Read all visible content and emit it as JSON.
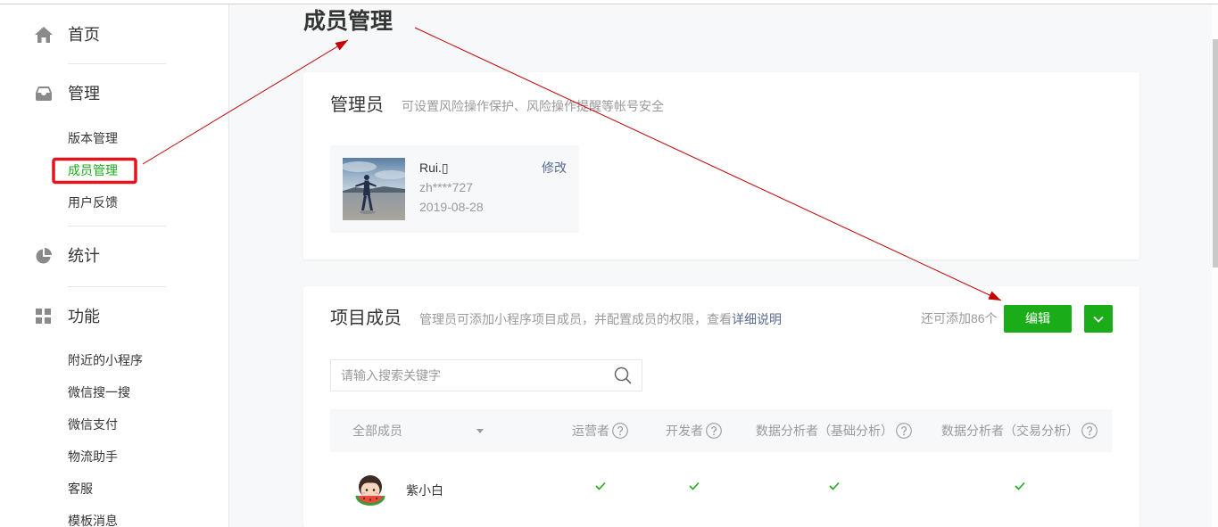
{
  "colors": {
    "accent": "#1aad19",
    "link": "#576b95",
    "text_primary": "#353535",
    "text_secondary": "#9a9a9a",
    "page_bg": "#f6f8f9",
    "annotation_box": "#e3141c",
    "annotation_arrow": "#c40000"
  },
  "sidebar": {
    "sections": [
      {
        "icon": "home-icon",
        "label": "首页",
        "items": []
      },
      {
        "icon": "inbox-icon",
        "label": "管理",
        "items": [
          {
            "label": "版本管理"
          },
          {
            "label": "成员管理",
            "active": true
          },
          {
            "label": "用户反馈"
          }
        ]
      },
      {
        "icon": "pie-chart-icon",
        "label": "统计",
        "items": []
      },
      {
        "icon": "grid-icon",
        "label": "功能",
        "items": [
          {
            "label": "附近的小程序"
          },
          {
            "label": "微信搜一搜"
          },
          {
            "label": "微信支付"
          },
          {
            "label": "物流助手"
          },
          {
            "label": "客服"
          },
          {
            "label": "模板消息"
          }
        ]
      }
    ]
  },
  "page_title": "成员管理",
  "admin_card": {
    "title": "管理员",
    "description": "可设置风险操作保护、风险操作提醒等帐号安全",
    "admin": {
      "name": "Rui.▯",
      "edit_label": "修改",
      "account": "zh****727",
      "date": "2019-08-28"
    }
  },
  "members_card": {
    "title": "项目成员",
    "description": "管理员可添加小程序项目成员，并配置成员的权限，查看",
    "detail_link": "详细说明",
    "remaining": "还可添加86个",
    "edit_button": "编辑",
    "search_placeholder": "请输入搜索关键字",
    "columns": [
      "全部成员",
      "运营者",
      "开发者",
      "数据分析者（基础分析）",
      "数据分析者（交易分析）"
    ],
    "rows": [
      {
        "name": "紫小白",
        "permissions": [
          true,
          true,
          true,
          true
        ]
      }
    ]
  }
}
